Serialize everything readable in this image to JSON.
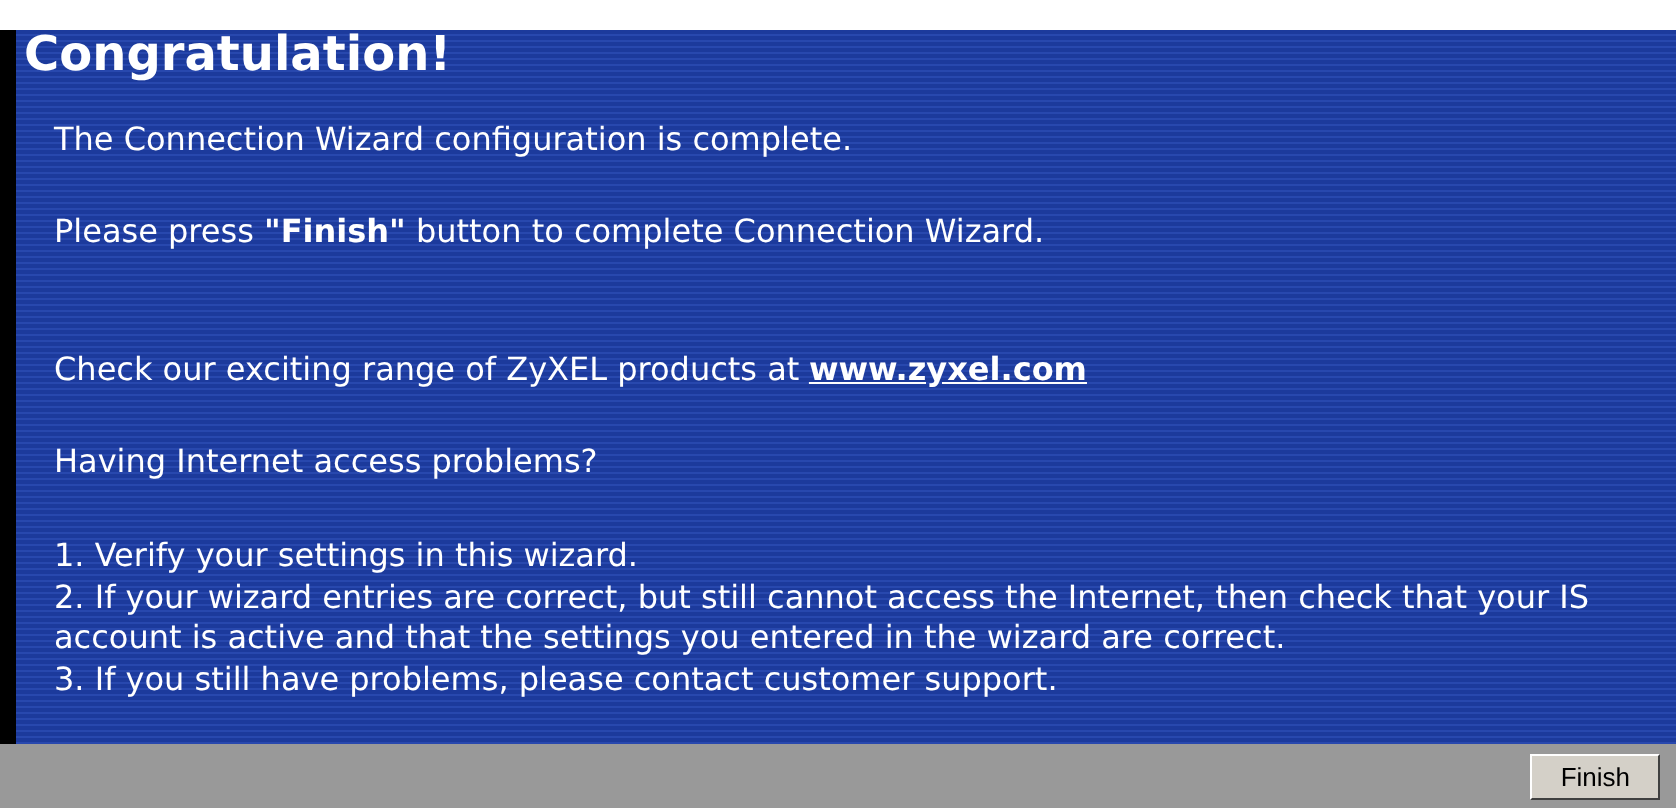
{
  "title": "Congratulation!",
  "messages": [
    {
      "kind": "text",
      "text": "The Connection Wizard configuration is complete."
    },
    {
      "kind": "text",
      "text": "Please press **\"Finish\"** button to complete Connection Wizard."
    },
    {
      "kind": "link",
      "text": "Check our exciting range of ZyXEL products at",
      "link": "www.zyxel.com"
    },
    {
      "kind": "text",
      "text": "Having Internet access problems?"
    }
  ],
  "steps": [
    {
      "lines": [
        "1. Verify your settings in this wizard."
      ]
    },
    {
      "lines": [
        "2. If your wizard entries are correct, but still cannot access the Internet, then check that your IS",
        "account is active and that the settings you entered in the wizard are correct."
      ]
    },
    {
      "lines": [
        "3. If you still have problems, please contact customer support."
      ]
    }
  ],
  "buttons": [
    "Finish"
  ]
}
